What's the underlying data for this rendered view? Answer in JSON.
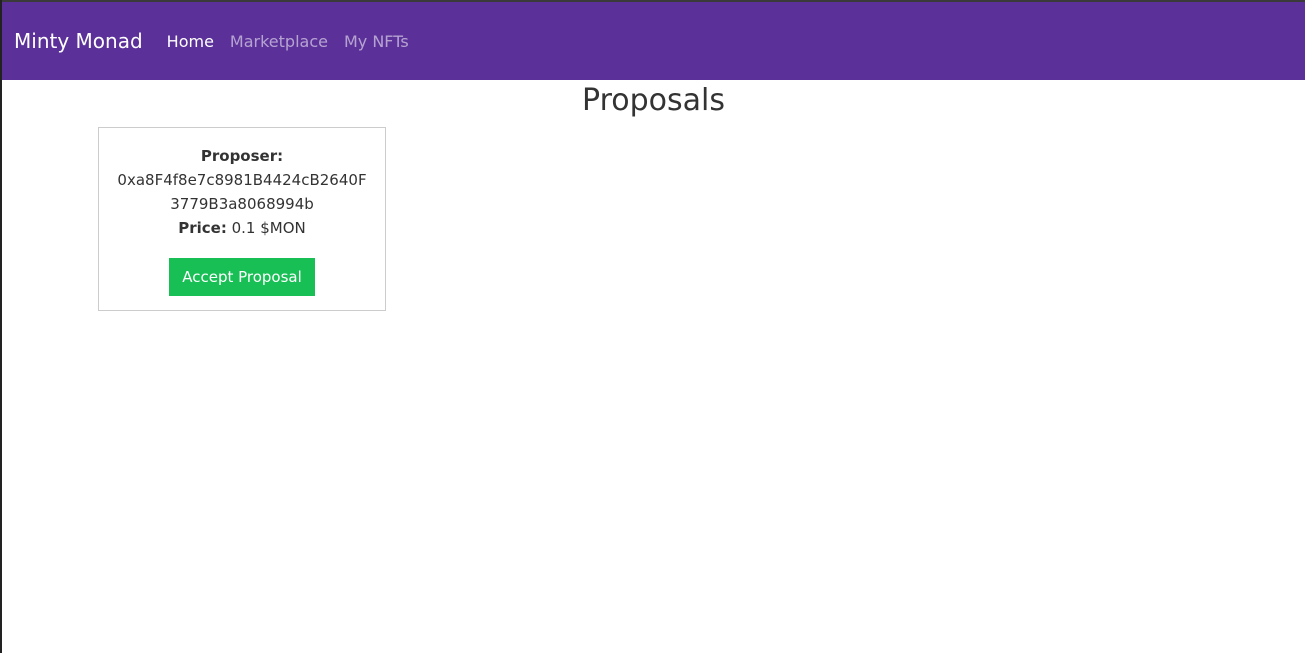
{
  "navbar": {
    "brand": "Minty Monad",
    "links": [
      {
        "label": "Home"
      },
      {
        "label": "Marketplace"
      },
      {
        "label": "My NFTs"
      }
    ]
  },
  "main": {
    "title": "Proposals",
    "proposals": [
      {
        "proposer_label": "Proposer:",
        "proposer_address": "0xa8F4f8e7c8981B4424cB2640F3779B3a8068994b",
        "price_label": "Price:",
        "price_value": " 0.1 $MON",
        "accept_label": "Accept Proposal"
      }
    ]
  },
  "colors": {
    "navbar_bg": "#5b3199",
    "accept_button_bg": "#17bf55"
  }
}
